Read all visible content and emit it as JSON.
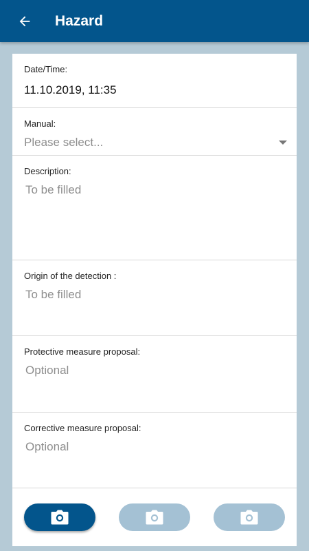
{
  "appbar": {
    "title": "Hazard",
    "back_icon": "arrow-left-icon"
  },
  "form": {
    "datetime": {
      "label": "Date/Time:",
      "value": "11.10.2019, 11:35"
    },
    "manual": {
      "label": "Manual:",
      "placeholder": "Please select..."
    },
    "description": {
      "label": "Description:",
      "placeholder": "To be filled"
    },
    "origin": {
      "label": "Origin of the detection :",
      "placeholder": "To be filled"
    },
    "protective": {
      "label": "Protective measure proposal:",
      "placeholder": "Optional"
    },
    "corrective": {
      "label": "Corrective measure proposal:",
      "placeholder": "Optional"
    }
  },
  "photos": {
    "icon": "camera-icon",
    "buttons": [
      {
        "state": "active"
      },
      {
        "state": "inactive"
      },
      {
        "state": "inactive"
      }
    ]
  },
  "colors": {
    "primary": "#03558c",
    "background": "#b5cad6",
    "button_inactive": "#a4c1d4",
    "placeholder": "#8e8e8e"
  }
}
